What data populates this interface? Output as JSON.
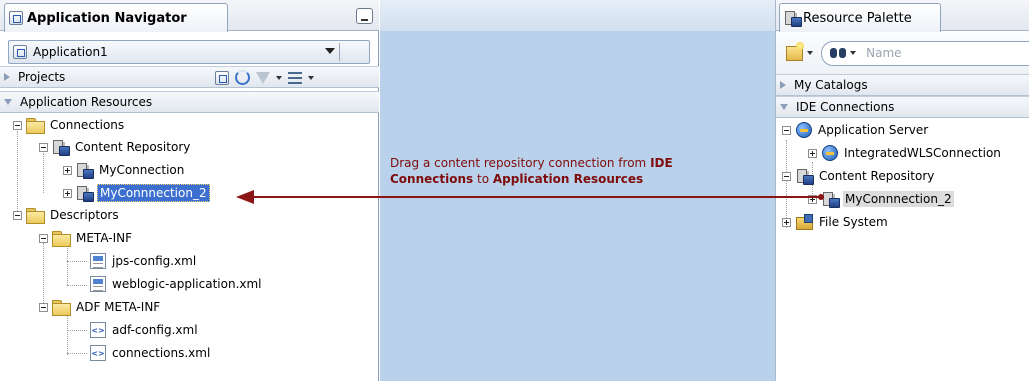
{
  "app_navigator": {
    "title": "Application Navigator",
    "application": "Application1",
    "projects_label": "Projects",
    "resources_label": "Application Resources",
    "tree": {
      "connections": "Connections",
      "content_repository": "Content Repository",
      "my_connection": "MyConnection",
      "my_connection_2": "MyConnnection_2",
      "descriptors": "Descriptors",
      "meta_inf": "META-INF",
      "jps_config": "jps-config.xml",
      "weblogic_app": "weblogic-application.xml",
      "adf_meta_inf": "ADF META-INF",
      "adf_config": "adf-config.xml",
      "connections_xml": "connections.xml"
    }
  },
  "instruction": {
    "prefix": "Drag a content repository connection from ",
    "ide_connections": "IDE Connections",
    "middle": " to ",
    "app_resources": "Application Resources"
  },
  "resource_palette": {
    "title": "Resource Palette",
    "search_placeholder": "Name",
    "my_catalogs": "My Catalogs",
    "ide_connections": "IDE Connections",
    "tree": {
      "application_server": "Application Server",
      "integrated_wls": "IntegratedWLSConnection",
      "content_repository": "Content Repository",
      "my_connection_2": "MyConnnection_2",
      "file_system": "File System"
    }
  },
  "colors": {
    "arrow": "#8b1414",
    "selection": "#3d6fd1",
    "instruction_text": "#7f0c0c",
    "middle_bg": "#b9d1ea"
  }
}
